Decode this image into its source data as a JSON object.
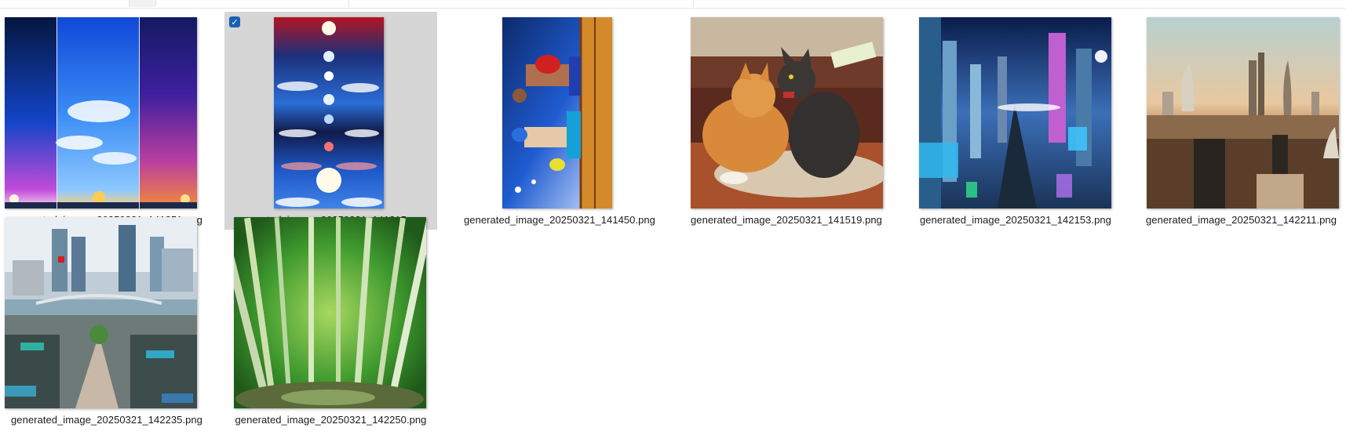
{
  "files": [
    {
      "name": "generated_image_20250321_141251.png",
      "selected": false,
      "thumb_icon": "sky-gradient-thumbnail"
    },
    {
      "name": "generated_image_20250321_141315.png",
      "selected": true,
      "thumb_icon": "sun-phases-thumbnail"
    },
    {
      "name": "generated_image_20250321_141450.png",
      "selected": false,
      "thumb_icon": "boxers-thumbnail"
    },
    {
      "name": "generated_image_20250321_141519.png",
      "selected": false,
      "thumb_icon": "cats-fighting-thumbnail"
    },
    {
      "name": "generated_image_20250321_142153.png",
      "selected": false,
      "thumb_icon": "futuristic-city-thumbnail"
    },
    {
      "name": "generated_image_20250321_142211.png",
      "selected": false,
      "thumb_icon": "desert-skyline-thumbnail"
    },
    {
      "name": "generated_image_20250321_142235.png",
      "selected": false,
      "thumb_icon": "city-market-thumbnail"
    },
    {
      "name": "generated_image_20250321_142250.png",
      "selected": false,
      "thumb_icon": "bamboo-forest-thumbnail"
    }
  ],
  "selection_check": "✓",
  "accent_color": "#1a5fb4",
  "selection_bg": "#d6d6d6"
}
